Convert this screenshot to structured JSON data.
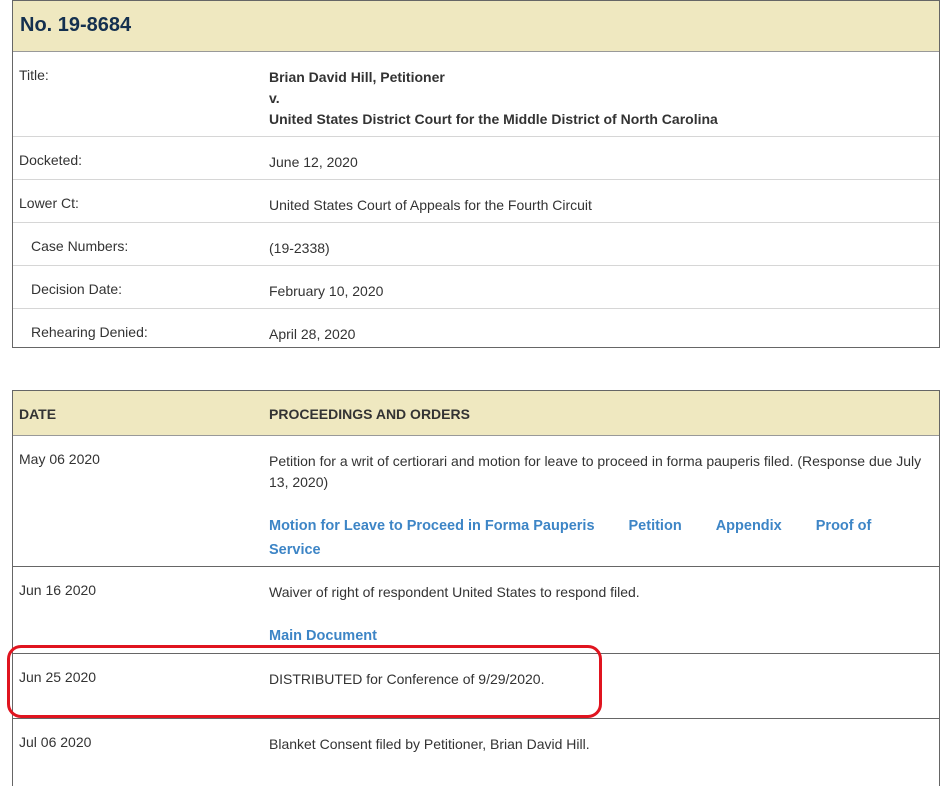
{
  "case": {
    "number": "No. 19-8684",
    "rows": [
      {
        "label": "Title:",
        "lines": [
          "Brian David Hill, Petitioner",
          "v.",
          "United States District Court for the Middle District of North Carolina"
        ]
      },
      {
        "label": "Docketed:",
        "value": "June 12, 2020"
      },
      {
        "label": "Lower Ct:",
        "value": "United States Court of Appeals for the Fourth Circuit"
      },
      {
        "label": "Case Numbers:",
        "value": "(19-2338)"
      },
      {
        "label": "Decision Date:",
        "value": "February 10, 2020"
      },
      {
        "label": "Rehearing Denied:",
        "value": "April 28, 2020"
      }
    ]
  },
  "proceedings": {
    "headers": {
      "date": "DATE",
      "proceedings": "PROCEEDINGS AND ORDERS"
    },
    "entries": [
      {
        "date": "May 06 2020",
        "text": "Petition for a writ of certiorari and motion for leave to proceed in forma pauperis filed. (Response due July 13, 2020)",
        "links": [
          "Motion for Leave to Proceed in Forma Pauperis",
          "Petition",
          "Appendix",
          "Proof of Service"
        ]
      },
      {
        "date": "Jun 16 2020",
        "text": "Waiver of right of respondent United States to respond filed.",
        "links": [
          "Main Document"
        ]
      },
      {
        "date": "Jun 25 2020",
        "text": "DISTRIBUTED for Conference of 9/29/2020."
      },
      {
        "date": "Jul 06 2020",
        "text": "Blanket Consent filed by Petitioner, Brian David Hill."
      }
    ]
  },
  "colors": {
    "header_bg": "#efe8c0",
    "case_no": "#14304f",
    "link": "#3d85c6",
    "highlight": "#e0141f"
  }
}
